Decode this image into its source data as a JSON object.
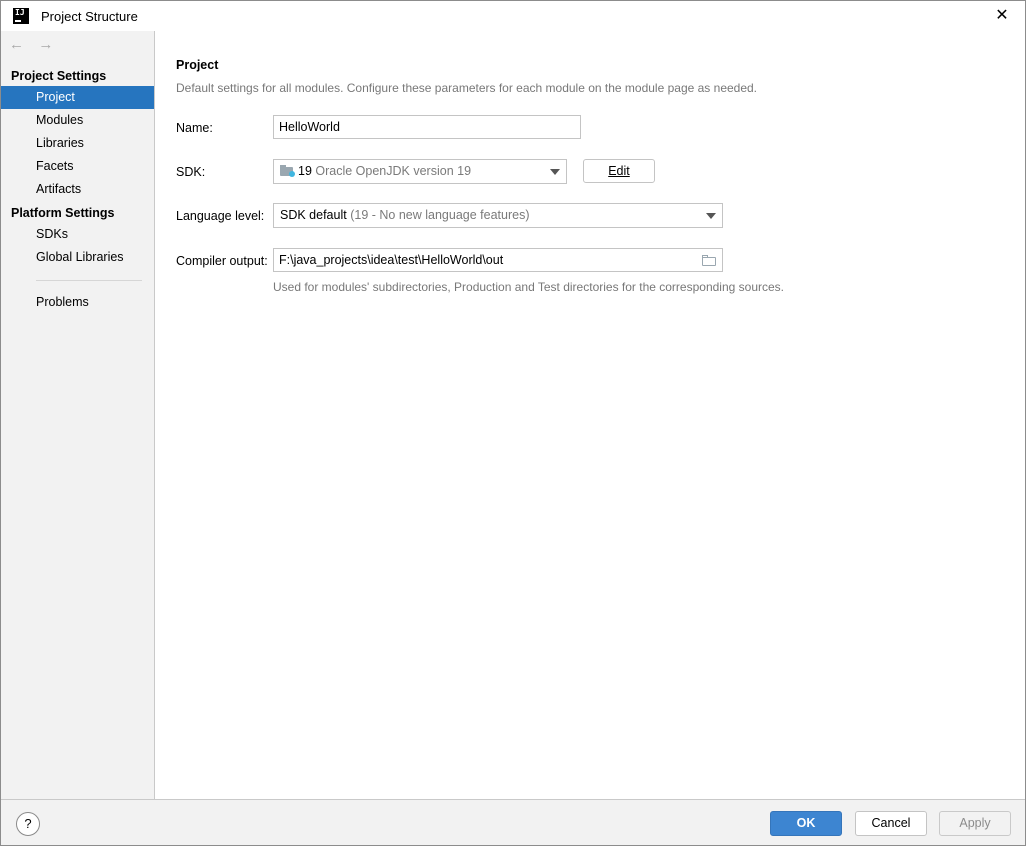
{
  "window": {
    "title": "Project Structure",
    "app_icon_text": "IJ",
    "close_glyph": "✕"
  },
  "sidebar": {
    "back_glyph": "←",
    "forward_glyph": "→",
    "group_project_settings": "Project Settings",
    "project_items": [
      "Project",
      "Modules",
      "Libraries",
      "Facets",
      "Artifacts"
    ],
    "group_platform_settings": "Platform Settings",
    "platform_items": [
      "SDKs",
      "Global Libraries"
    ],
    "problems": "Problems",
    "selected": "Project"
  },
  "main": {
    "title": "Project",
    "description": "Default settings for all modules. Configure these parameters for each module on the module page as needed.",
    "name_label": "Name:",
    "name_value": "HelloWorld",
    "sdk_label": "SDK:",
    "sdk_version": "19",
    "sdk_name": "Oracle OpenJDK version 19",
    "edit_button": "Edit",
    "language_level_label": "Language level:",
    "language_level_value": "SDK default",
    "language_level_detail": "(19 - No new language features)",
    "compiler_output_label": "Compiler output:",
    "compiler_output_value": "F:\\java_projects\\idea\\test\\HelloWorld\\out",
    "compiler_output_hint": "Used for modules' subdirectories, Production and Test directories for the corresponding sources."
  },
  "footer": {
    "help_glyph": "?",
    "ok": "OK",
    "cancel": "Cancel",
    "apply": "Apply"
  },
  "colors": {
    "selection": "#2675bf",
    "ok_button": "#3d85d1",
    "sidebar_bg": "#f2f2f2",
    "hint_text": "#787878"
  }
}
